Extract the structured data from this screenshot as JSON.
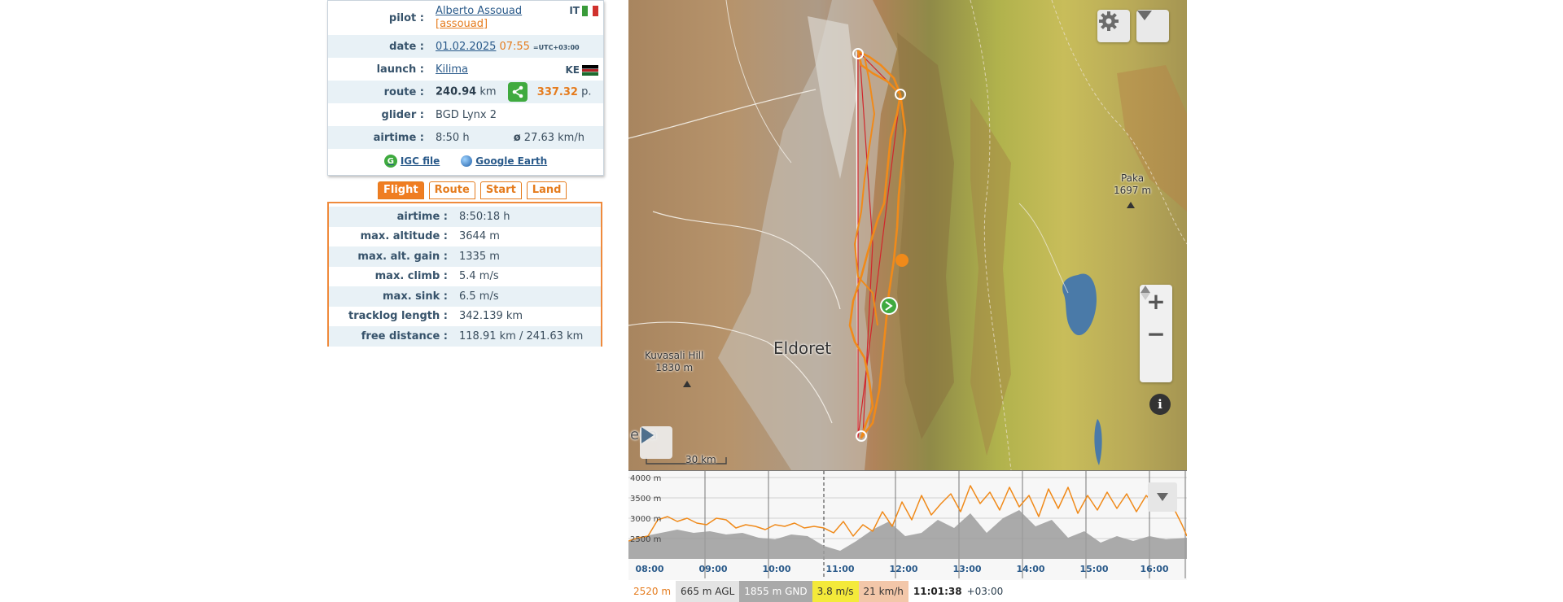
{
  "flight_info": {
    "pilot_label": "pilot :",
    "pilot_name": "Alberto Assouad",
    "pilot_nick": "[assouad]",
    "pilot_country": "IT",
    "date_label": "date :",
    "date": "01.02.2025",
    "time": "07:55",
    "timezone": "=UTC+03:00",
    "launch_label": "launch :",
    "launch": "Kilima",
    "launch_country": "KE",
    "route_label": "route :",
    "route_km": "240.94",
    "route_unit": "km",
    "route_points": "337.32",
    "route_points_unit": "p.",
    "glider_label": "glider :",
    "glider": "BGD Lynx 2",
    "airtime_label": "airtime :",
    "airtime": "8:50 h",
    "avg_speed_prefix": "ø",
    "avg_speed": "27.63 km/h",
    "igc_label": "IGC file",
    "google_earth_label": "Google Earth",
    "flag_it_colors": [
      "#3a9b3a",
      "#ffffff",
      "#d0312d"
    ]
  },
  "tabs": [
    {
      "label": "Flight",
      "active": true
    },
    {
      "label": "Route",
      "active": false
    },
    {
      "label": "Start",
      "active": false
    },
    {
      "label": "Land",
      "active": false
    }
  ],
  "stats": [
    {
      "label": "airtime :",
      "value": "8:50:18 h"
    },
    {
      "label": "max. altitude :",
      "value": "3644 m"
    },
    {
      "label": "max. alt. gain :",
      "value": "1335 m"
    },
    {
      "label": "max. climb :",
      "value": "5.4 m/s"
    },
    {
      "label": "max. sink :",
      "value": "6.5 m/s"
    },
    {
      "label": "tracklog length :",
      "value": "342.139 km"
    },
    {
      "label": "free distance :",
      "value": "118.91 km / 241.63 km"
    }
  ],
  "map": {
    "labels": {
      "eldoret": "Eldoret",
      "kuvasali_name": "Kuvasali Hill",
      "kuvasali_alt": "1830 m",
      "paka_name": "Paka",
      "paka_alt": "1697 m",
      "scale": "30 km",
      "edge_text": "ega"
    },
    "buttons": {
      "settings": "gear-icon",
      "menu": "chevron-down-icon",
      "zoom_in": "+",
      "zoom_out": "−",
      "compass": "▲",
      "info": "i",
      "play": "play-icon"
    }
  },
  "alt_chart": {
    "y_labels": [
      "4000 m",
      "3500 m",
      "3000 m",
      "2500 m"
    ],
    "x_labels": [
      "08:00",
      "09:00",
      "10:00",
      "11:00",
      "12:00",
      "13:00",
      "14:00",
      "15:00",
      "16:00"
    ]
  },
  "status": {
    "altitude": "2520 m",
    "agl": "665 m AGL",
    "gnd": "1855 m GND",
    "vario": "3.8 m/s",
    "speed": "21 km/h",
    "time": "11:01:38",
    "tz": "+03:00"
  }
}
